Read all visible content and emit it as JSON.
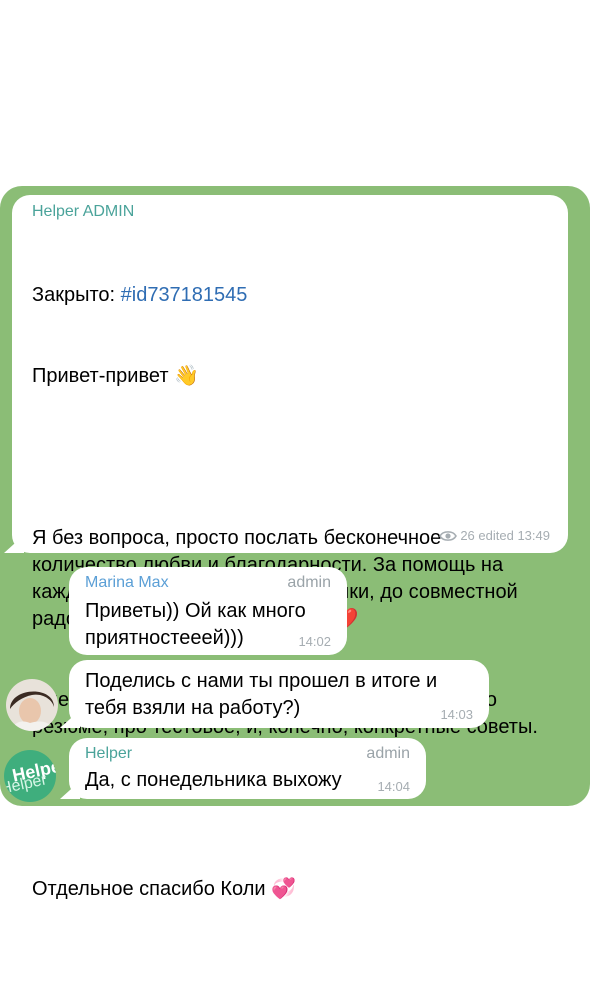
{
  "messages": [
    {
      "sender": "Helper ADMIN",
      "line1_prefix": "Закрыто: ",
      "hashtag": "#id737181545",
      "greeting": "Привет-привет",
      "greeting_emoji": "👋",
      "para1": "Я без вопроса, просто послать бесконечное количество любви и благодарности. За помощь на каждом этапе начиная с резюмешки, до совместной радости подписанному офферу",
      "heart_emoji": "❤️",
      "para2": "Очень помогли интенсивы про исследования, про резюме, про тестовое, и, конечно, конкретные советы.",
      "thanks": "Отдельное спасибо Коли",
      "thanks_emoji": "💞",
      "views": "26",
      "edited_time": "edited 13:49"
    },
    {
      "sender": "Marina Max",
      "role": "admin",
      "text": "Приветы)) Ой как много приятностееей)))",
      "time": "14:02"
    },
    {
      "text": "Поделись с нами ты прошел в итоге и тебя взяли на работу?)",
      "time": "14:03"
    },
    {
      "sender": "Helper",
      "role": "admin",
      "text": "Да, с понедельника выхожу",
      "time": "14:04"
    }
  ],
  "colors": {
    "chat_background": "#8bbd76",
    "helper_name": "#4aa39a",
    "marina_name": "#5b9fd6",
    "hashtag": "#2f6db3"
  },
  "icons": [
    "eye-icon",
    "waving-hand-emoji",
    "red-heart-emoji",
    "two-hearts-emoji",
    "helper-logo-avatar",
    "user-photo-avatar"
  ],
  "avatar_logo_text": "Helper"
}
